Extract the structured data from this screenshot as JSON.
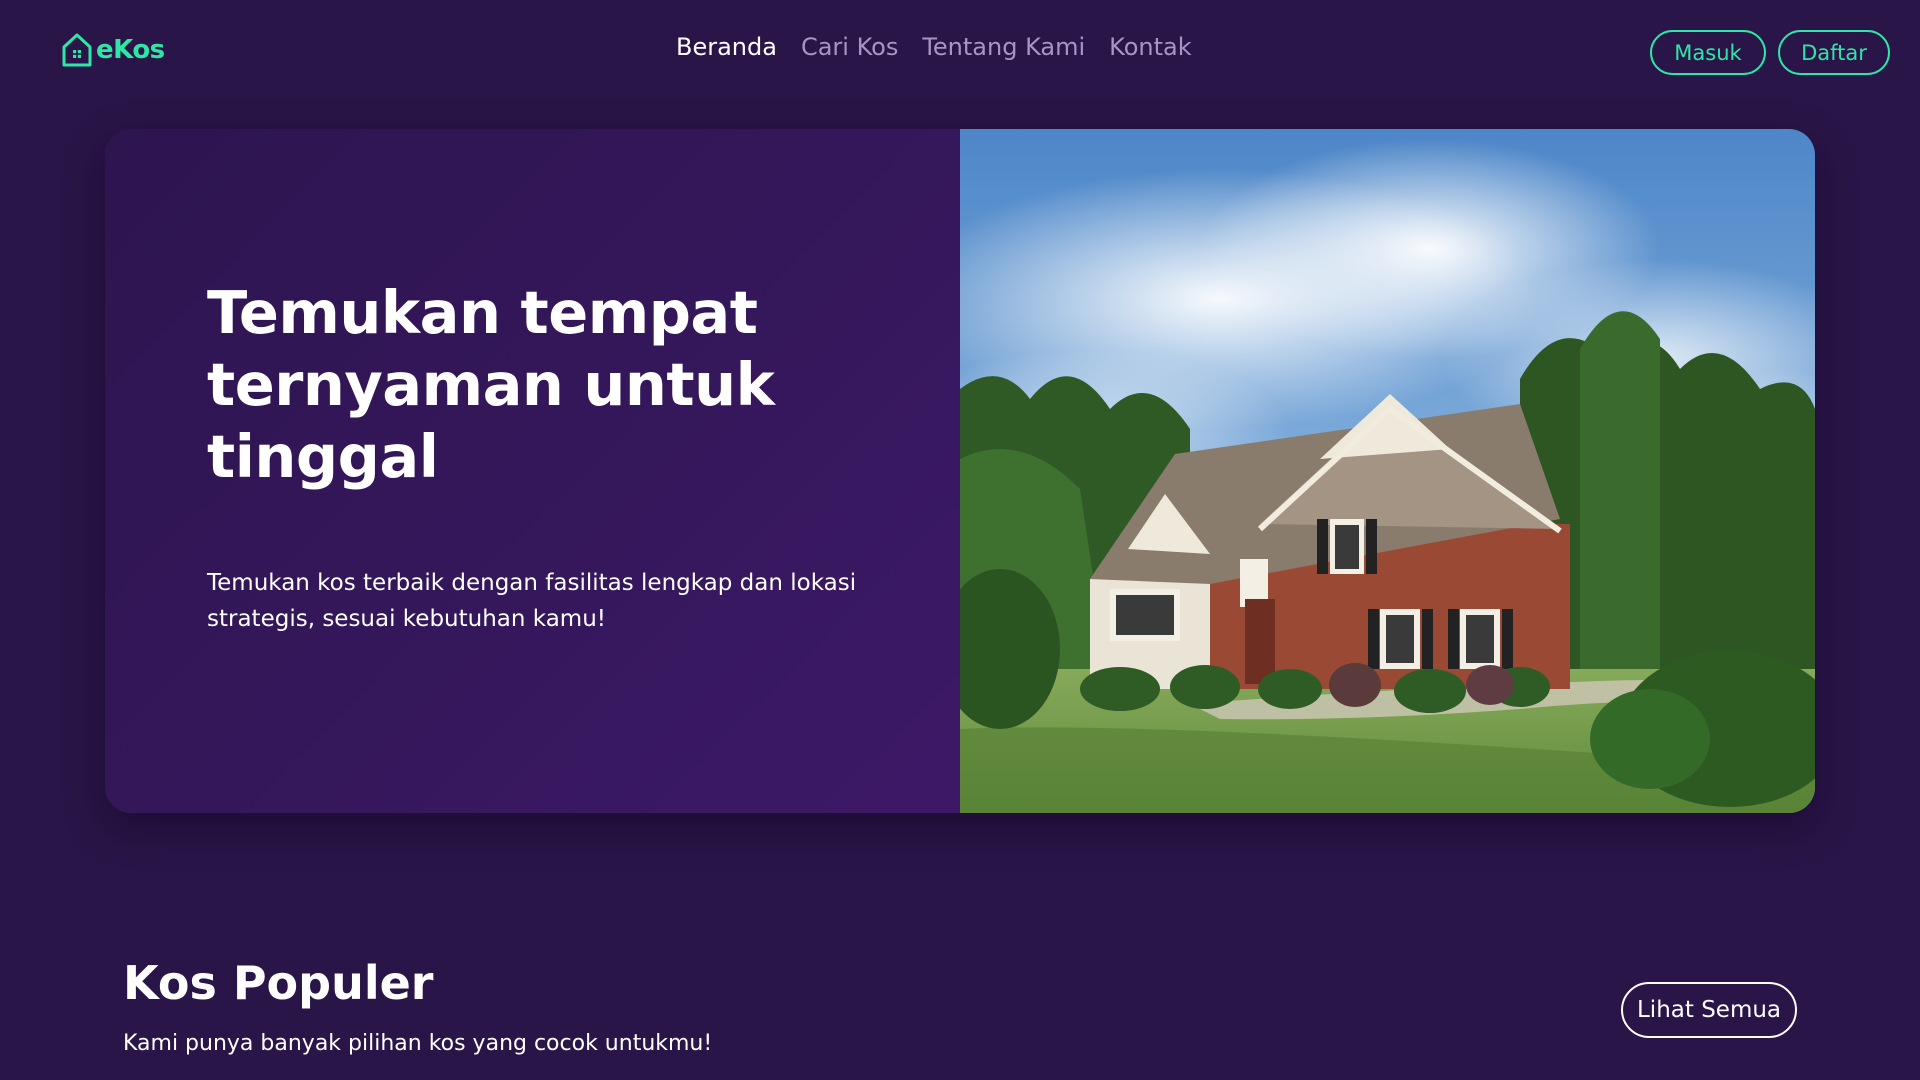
{
  "brand": {
    "name": "eKos",
    "icon": "house-icon",
    "color": "#2ee6a6"
  },
  "nav": {
    "items": [
      {
        "label": "Beranda",
        "active": true
      },
      {
        "label": "Cari Kos",
        "active": false
      },
      {
        "label": "Tentang Kami",
        "active": false
      },
      {
        "label": "Kontak",
        "active": false
      }
    ]
  },
  "auth": {
    "login_label": "Masuk",
    "register_label": "Daftar"
  },
  "hero": {
    "title": "Temukan tempat ternyaman untuk tinggal",
    "description": "Temukan kos terbaik dengan fasilitas lengkap dan lokasi strategis, sesuai kebutuhan kamu!",
    "image": "suburban-house-photo"
  },
  "popular": {
    "title": "Kos Populer",
    "subtitle": "Kami punya banyak pilihan kos yang cocok untukmu!",
    "view_all_label": "Lihat Semua"
  },
  "colors": {
    "background": "#2a1548",
    "accent": "#2ee6a6",
    "nav_inactive": "#a696c4"
  }
}
